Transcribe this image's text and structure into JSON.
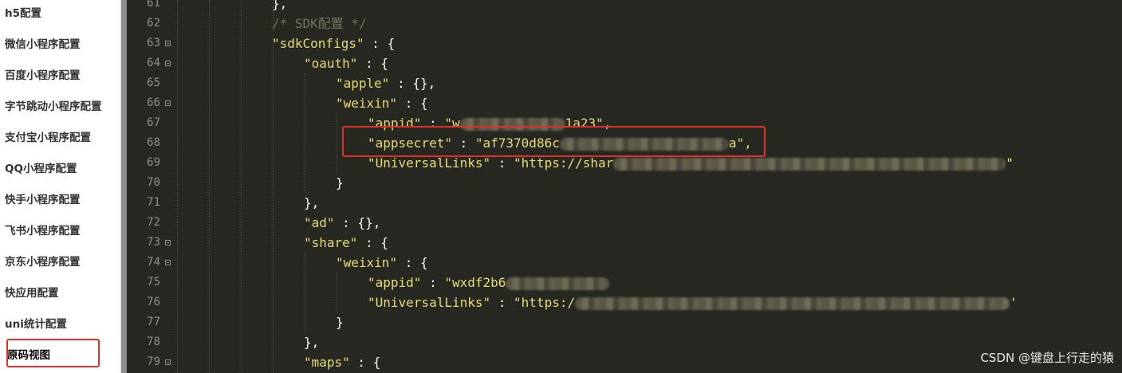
{
  "sidebar": {
    "items": [
      {
        "label": "h5配置"
      },
      {
        "label": "微信小程序配置"
      },
      {
        "label": "百度小程序配置"
      },
      {
        "label": "字节跳动小程序配置"
      },
      {
        "label": "支付宝小程序配置"
      },
      {
        "label": "QQ小程序配置"
      },
      {
        "label": "快手小程序配置"
      },
      {
        "label": "飞书小程序配置"
      },
      {
        "label": "京东小程序配置"
      },
      {
        "label": "快应用配置"
      },
      {
        "label": "uni统计配置"
      },
      {
        "label": "原码视图"
      }
    ],
    "active_index": 11
  },
  "editor": {
    "lines": [
      {
        "num": "61",
        "fold": false
      },
      {
        "num": "62",
        "fold": false
      },
      {
        "num": "63",
        "fold": true
      },
      {
        "num": "64",
        "fold": true
      },
      {
        "num": "65",
        "fold": false
      },
      {
        "num": "66",
        "fold": true
      },
      {
        "num": "67",
        "fold": false
      },
      {
        "num": "68",
        "fold": false
      },
      {
        "num": "69",
        "fold": false
      },
      {
        "num": "70",
        "fold": false
      },
      {
        "num": "71",
        "fold": false
      },
      {
        "num": "72",
        "fold": false
      },
      {
        "num": "73",
        "fold": true
      },
      {
        "num": "74",
        "fold": true
      },
      {
        "num": "75",
        "fold": false
      },
      {
        "num": "76",
        "fold": false
      },
      {
        "num": "77",
        "fold": false
      },
      {
        "num": "78",
        "fold": false
      },
      {
        "num": "79",
        "fold": true
      }
    ],
    "code": {
      "l61": "},",
      "l62": "/* SDK配置 */",
      "l63_key": "\"sdkConfigs\"",
      "l63_rest": " : {",
      "l64_key": "\"oauth\"",
      "l64_rest": " : {",
      "l65_key": "\"apple\"",
      "l65_rest": " : {},",
      "l66_key": "\"weixin\"",
      "l66_rest": " : {",
      "l67_key": "\"appid\"",
      "l67_sep": " : ",
      "l67_val_start": "\"w",
      "l67_val_end": "1a23\",",
      "l68_key": "\"appsecret\"",
      "l68_sep": " : ",
      "l68_val_start": "\"af7370d86c",
      "l68_val_end": "a\",",
      "l69_key": "\"UniversalLinks\"",
      "l69_sep": " : ",
      "l69_val_start": "\"https://shar",
      "l69_val_end": "\"",
      "l70": "}",
      "l71": "},",
      "l72_key": "\"ad\"",
      "l72_rest": " : {},",
      "l73_key": "\"share\"",
      "l73_rest": " : {",
      "l74_key": "\"weixin\"",
      "l74_rest": " : {",
      "l75_key": "\"appid\"",
      "l75_sep": " : ",
      "l75_val_start": "\"wxdf2b6",
      "l76_key": "\"UniversalLinks\"",
      "l76_sep": " : ",
      "l76_val_start": "\"https:/",
      "l76_val_end": "'",
      "l77": "}",
      "l78": "},",
      "l79_key": "\"maps\"",
      "l79_rest": " : {"
    }
  },
  "watermark": "CSDN @键盘上行走的猿",
  "colors": {
    "editor_bg": "#272822",
    "string": "#e6db74",
    "comment": "#75715e",
    "highlight_box": "#e0312b"
  }
}
